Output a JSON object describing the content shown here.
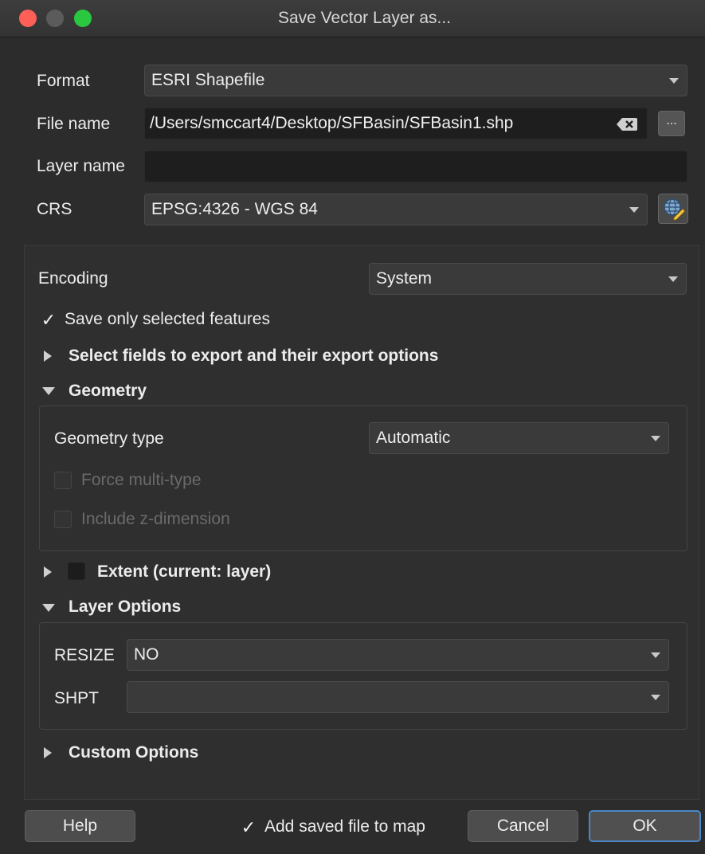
{
  "window": {
    "title": "Save Vector Layer as..."
  },
  "form": {
    "format_label": "Format",
    "format_value": "ESRI Shapefile",
    "filename_label": "File name",
    "filename_value": "/Users/smccart4/Desktop/SFBasin/SFBasin1.shp",
    "browse_label": "...",
    "layername_label": "Layer name",
    "layername_value": "",
    "crs_label": "CRS",
    "crs_value": "EPSG:4326 - WGS 84"
  },
  "options": {
    "encoding_label": "Encoding",
    "encoding_value": "System",
    "save_selected_label": "Save only selected features",
    "save_selected_checked": true,
    "select_fields_label": "Select fields to export and their export options",
    "geometry_label": "Geometry",
    "geometry_type_label": "Geometry type",
    "geometry_type_value": "Automatic",
    "force_multi_label": "Force multi-type",
    "include_z_label": "Include z-dimension",
    "extent_label": "Extent (current: layer)",
    "layer_options_label": "Layer Options",
    "resize_label": "RESIZE",
    "resize_value": "NO",
    "shpt_label": "SHPT",
    "shpt_value": "",
    "custom_options_label": "Custom Options"
  },
  "footer": {
    "help_label": "Help",
    "add_to_map_label": "Add saved file to map",
    "add_to_map_checked": true,
    "cancel_label": "Cancel",
    "ok_label": "OK"
  },
  "colors": {
    "close": "#fe5f57",
    "minimize": "#5b5b5b",
    "zoom": "#2ac840",
    "accent": "#4b86c7"
  }
}
